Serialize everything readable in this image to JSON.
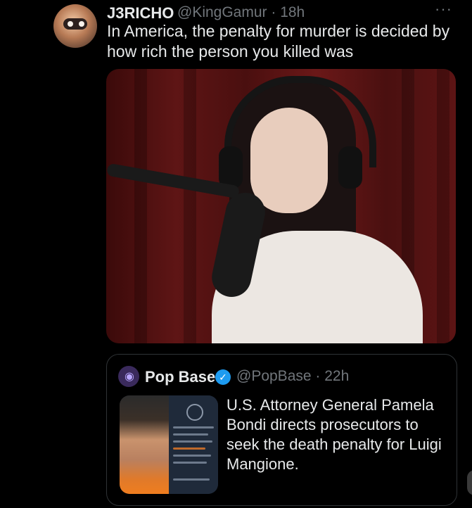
{
  "tweet": {
    "author_name": "J3RICHO",
    "handle_time": "@KingGamur · 18h",
    "more": "···",
    "text": "In America, the penalty for murder is decided by how rich the person you killed was"
  },
  "quote": {
    "author_name": "Pop Base",
    "handle_time": "@PopBase · 22h",
    "text": "U.S. Attorney General Pamela Bondi directs prosecutors to seek the death penalty for Luigi Mangione."
  },
  "colors": {
    "background": "#000000",
    "text_primary": "#e7e9ea",
    "text_secondary": "#71767b",
    "verified_badge": "#1d9bf0",
    "border": "#2f3336"
  },
  "icons": {
    "more": "more-icon",
    "verified": "verified-badge-icon"
  }
}
